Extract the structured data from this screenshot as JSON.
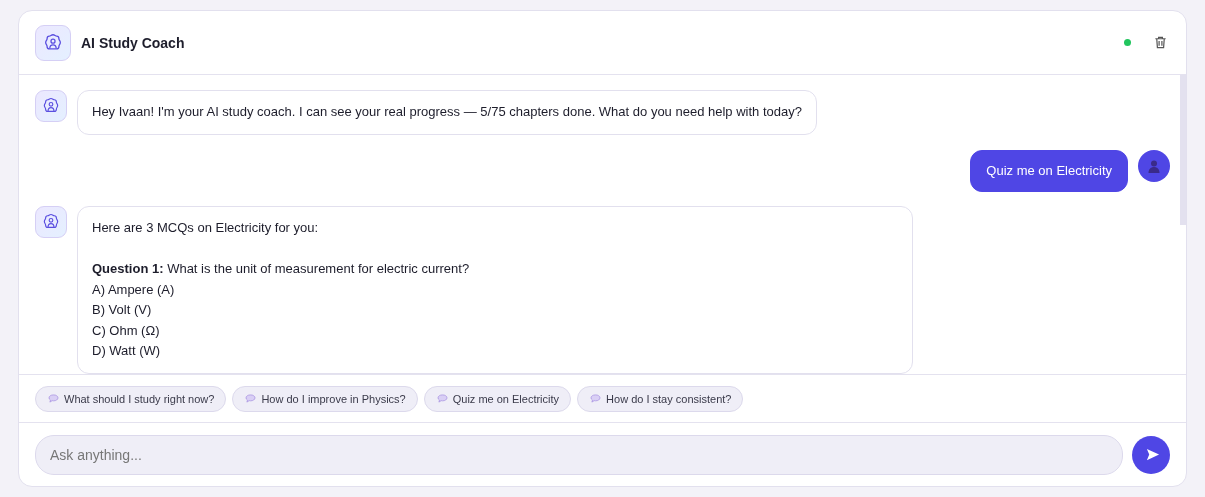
{
  "header": {
    "title": "AI Study Coach",
    "online": true
  },
  "messages": [
    {
      "kind": "bot",
      "paragraphs": [
        [
          "Hey Ivaan! I'm your AI study coach. I can see your real progress — 5/75 chapters done. What do you need help with today?"
        ]
      ]
    },
    {
      "kind": "user",
      "paragraphs": [
        [
          "Quiz me on Electricity"
        ]
      ]
    },
    {
      "kind": "bot",
      "paragraphs": [
        [
          "Here are 3 MCQs on Electricity for you:"
        ],
        [
          "**Question 1:** What is the unit of measurement for electric current?",
          "A) Ampere (A)",
          "B) Volt (V)",
          "C) Ohm (Ω)",
          "D) Watt (W)"
        ]
      ]
    }
  ],
  "suggestions": [
    "What should I study right now?",
    "How do I improve in Physics?",
    "Quiz me on Electricity",
    "How do I stay consistent?"
  ],
  "composer": {
    "placeholder": "Ask anything..."
  }
}
